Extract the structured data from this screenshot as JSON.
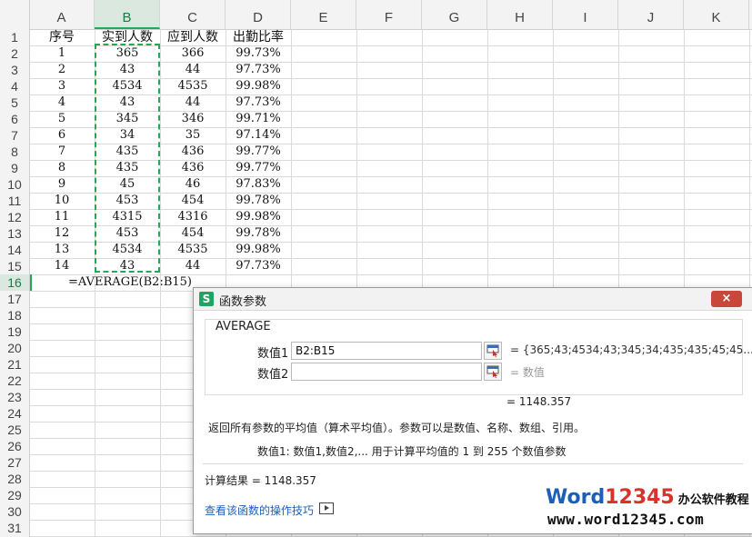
{
  "sheet": {
    "columns": [
      "A",
      "B",
      "C",
      "D",
      "E",
      "F",
      "G",
      "H",
      "I",
      "J",
      "K"
    ],
    "active_column": "B",
    "rows": [
      "1",
      "2",
      "3",
      "4",
      "5",
      "6",
      "7",
      "8",
      "9",
      "10",
      "11",
      "12",
      "13",
      "14",
      "15",
      "16",
      "17",
      "18",
      "19",
      "20",
      "21",
      "22",
      "23",
      "24",
      "25",
      "26",
      "27",
      "28",
      "29",
      "30",
      "31"
    ],
    "active_row": "16",
    "headers": [
      "序号",
      "实到人数",
      "应到人数",
      "出勤比率"
    ],
    "data": [
      [
        "1",
        "365",
        "366",
        "99.73%"
      ],
      [
        "2",
        "43",
        "44",
        "97.73%"
      ],
      [
        "3",
        "4534",
        "4535",
        "99.98%"
      ],
      [
        "4",
        "43",
        "44",
        "97.73%"
      ],
      [
        "5",
        "345",
        "346",
        "99.71%"
      ],
      [
        "6",
        "34",
        "35",
        "97.14%"
      ],
      [
        "7",
        "435",
        "436",
        "99.77%"
      ],
      [
        "8",
        "435",
        "436",
        "99.77%"
      ],
      [
        "9",
        "45",
        "46",
        "97.83%"
      ],
      [
        "10",
        "453",
        "454",
        "99.78%"
      ],
      [
        "11",
        "4315",
        "4316",
        "99.98%"
      ],
      [
        "12",
        "453",
        "454",
        "99.78%"
      ],
      [
        "13",
        "4534",
        "4535",
        "99.98%"
      ],
      [
        "14",
        "43",
        "44",
        "97.73%"
      ]
    ],
    "formula": "=AVERAGE(B2:B15)"
  },
  "dialog": {
    "title": "函数参数",
    "close_label": "×",
    "app_icon_label": "S",
    "function_name": "AVERAGE",
    "args": [
      {
        "label": "数值1",
        "value": "B2:B15",
        "result": "= {365;43;4534;43;345;34;435;435;45;45..."
      },
      {
        "label": "数值2",
        "value": "",
        "result": "= 数值"
      }
    ],
    "total_result": "= 1148.357",
    "description": "返回所有参数的平均值（算术平均值）。参数可以是数值、名称、数组、引用。",
    "param_description": "数值1:   数值1,数值2,... 用于计算平均值的 1 到 255 个数值参数",
    "calc_result": "计算结果 = 1148.357",
    "help_link": "查看该函数的操作技巧"
  },
  "watermark": {
    "brand_word": "Word",
    "brand_num": "12345",
    "brand_cn": "办公软件教程",
    "url": "www.word12345.com"
  },
  "colors": {
    "accent_green": "#2aa557",
    "close_red": "#c9473a",
    "link_blue": "#1d5fb8"
  }
}
